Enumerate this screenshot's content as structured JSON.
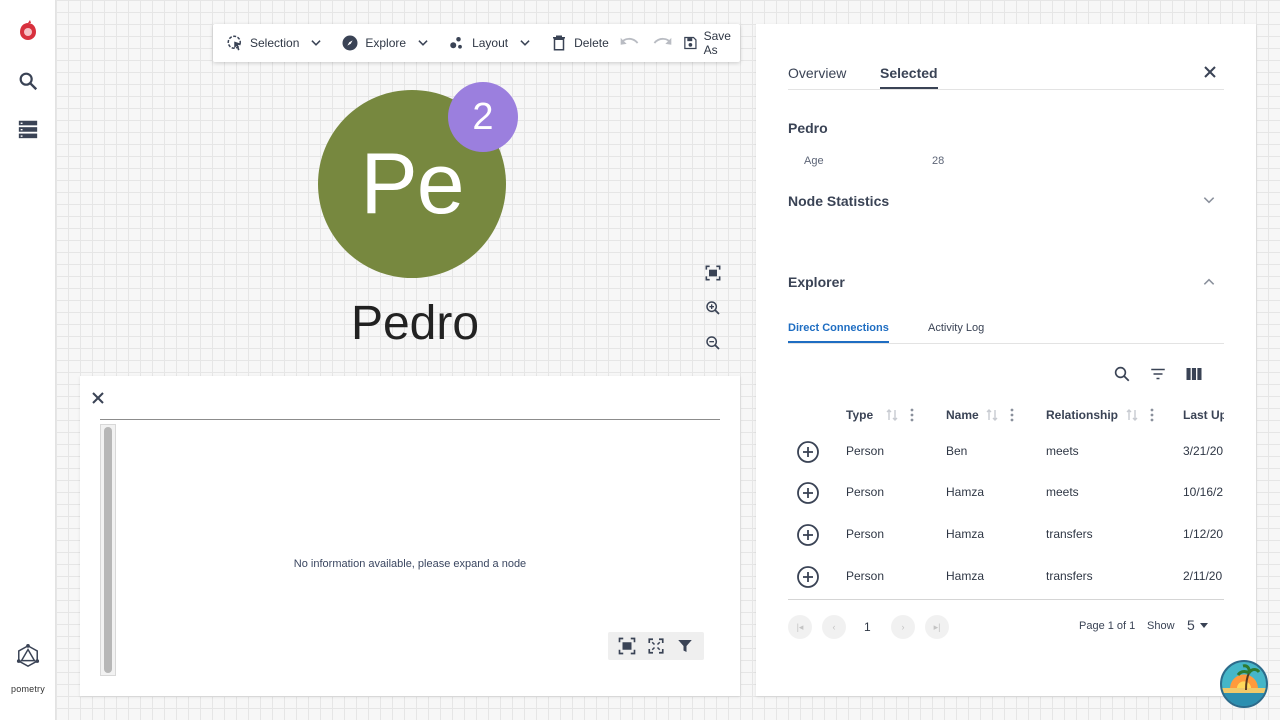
{
  "rail": {
    "brand": "pometry",
    "items": [
      "logo-icon",
      "search-icon",
      "storage-icon",
      "graph-icon"
    ]
  },
  "toolbar": {
    "selection": "Selection",
    "explore": "Explore",
    "layout": "Layout",
    "delete": "Delete",
    "save_as": "Save As"
  },
  "graph": {
    "node_initials": "Pe",
    "node_badge": "2",
    "node_label": "Pedro",
    "node_color": "#77883f",
    "badge_color": "#9b7fde"
  },
  "info_panel": {
    "empty_message": "No information available, please expand a node"
  },
  "side_panel": {
    "tabs": [
      "Overview",
      "Selected"
    ],
    "active_tab": "Selected",
    "node_name": "Pedro",
    "properties": [
      {
        "key": "Age",
        "value": "28"
      }
    ],
    "node_statistics": "Node Statistics",
    "explorer": "Explorer",
    "subtabs": [
      "Direct Connections",
      "Activity Log"
    ],
    "table": {
      "headers": [
        "Type",
        "Name",
        "Relationship",
        "Last Up"
      ],
      "rows": [
        {
          "type": "Person",
          "name": "Ben",
          "relationship": "meets",
          "last_updated": "3/21/20"
        },
        {
          "type": "Person",
          "name": "Hamza",
          "relationship": "meets",
          "last_updated": "10/16/2"
        },
        {
          "type": "Person",
          "name": "Hamza",
          "relationship": "transfers",
          "last_updated": "1/12/20"
        },
        {
          "type": "Person",
          "name": "Hamza",
          "relationship": "transfers",
          "last_updated": "2/11/20"
        }
      ]
    },
    "pagination": {
      "current_page": "1",
      "page_info": "Page 1 of 1",
      "show_label": "Show",
      "page_size": "5"
    }
  },
  "colors": {
    "accent": "#1e6dc2",
    "text": "#3a4355"
  }
}
